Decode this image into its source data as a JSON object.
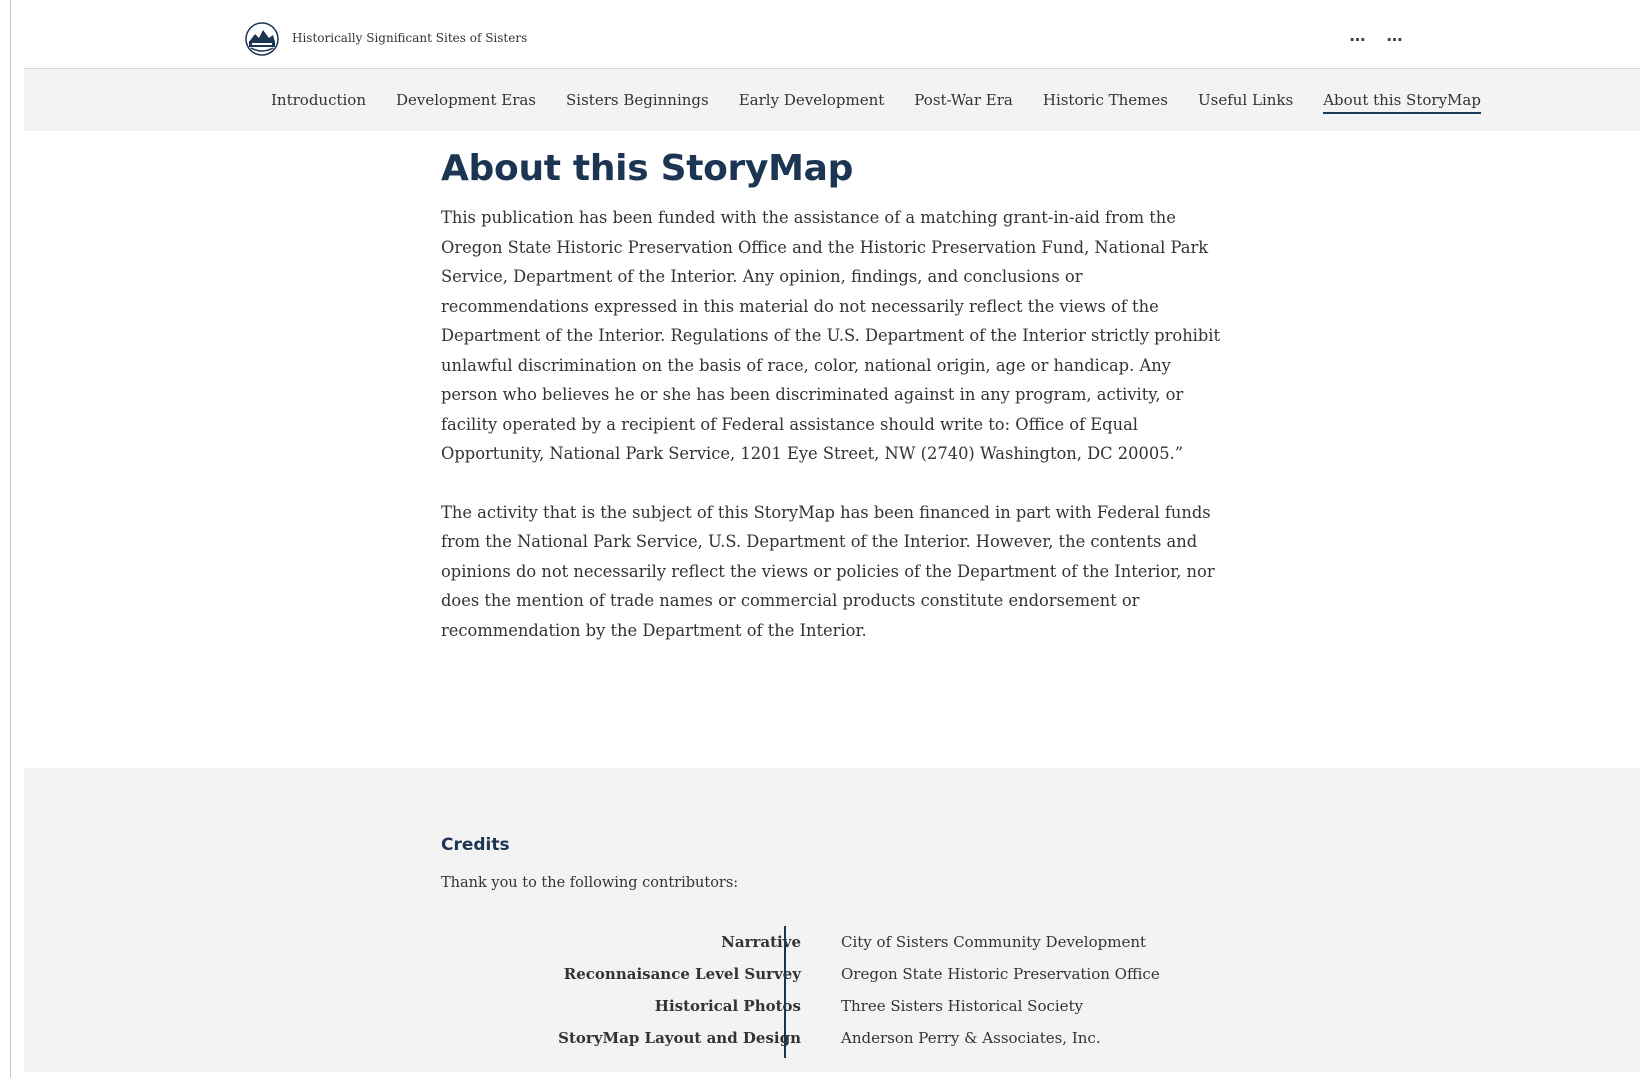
{
  "header": {
    "site_title": "Historically Significant Sites of Sisters",
    "menu_more_1": "…",
    "menu_more_2": "…"
  },
  "nav": {
    "items": [
      {
        "label": "Introduction"
      },
      {
        "label": "Development Eras"
      },
      {
        "label": "Sisters Beginnings"
      },
      {
        "label": "Early Development"
      },
      {
        "label": "Post-War Era"
      },
      {
        "label": "Historic Themes"
      },
      {
        "label": "Useful Links"
      },
      {
        "label": "About this StoryMap"
      }
    ],
    "active_index": 7
  },
  "main": {
    "title": "About this StoryMap",
    "paragraphs": [
      "This publication has been funded with the assistance of a matching grant-in-aid from the Oregon State Historic Preservation Office and the Historic Preservation Fund, National Park Service, Department of the Interior.  Any opinion, findings, and conclusions or recommendations expressed in this material do not necessarily reflect the views of the Department of the Interior. Regulations of the U.S. Department of the Interior strictly prohibit unlawful discrimination on the basis of race, color, national origin, age or handicap.  Any person who believes he or she has been discriminated against in any program, activity, or facility operated by a recipient of Federal assistance should write to: Office of Equal Opportunity, National Park Service, 1201 Eye Street, NW (2740) Washington, DC 20005.”",
      "The activity that is the subject of this StoryMap has been financed in part with Federal funds from the National Park Service, U.S. Department of the Interior. However, the contents and opinions do not necessarily reflect the views or policies of the Department of the Interior, nor does the mention of trade names or commercial products constitute endorsement or recommendation by the Department of the Interior."
    ]
  },
  "credits": {
    "title": "Credits",
    "intro": "Thank you to the following contributors:",
    "rows": [
      {
        "role": "Narrative",
        "name": "City of Sisters Community Development"
      },
      {
        "role": "Reconnaisance Level Survey",
        "name": "Oregon State Historic Preservation Office"
      },
      {
        "role": "Historical Photos",
        "name": "Three Sisters Historical Society"
      },
      {
        "role": "StoryMap Layout and  Design",
        "name": "Anderson Perry & Associates, Inc."
      }
    ]
  },
  "colors": {
    "accent": "#1c3553",
    "nav_background": "#f3f3f3",
    "footer_background": "#f3f3f3"
  },
  "icons": {
    "logo": "sisters-city-seal-icon",
    "menu": "more-horizontal-icon"
  }
}
